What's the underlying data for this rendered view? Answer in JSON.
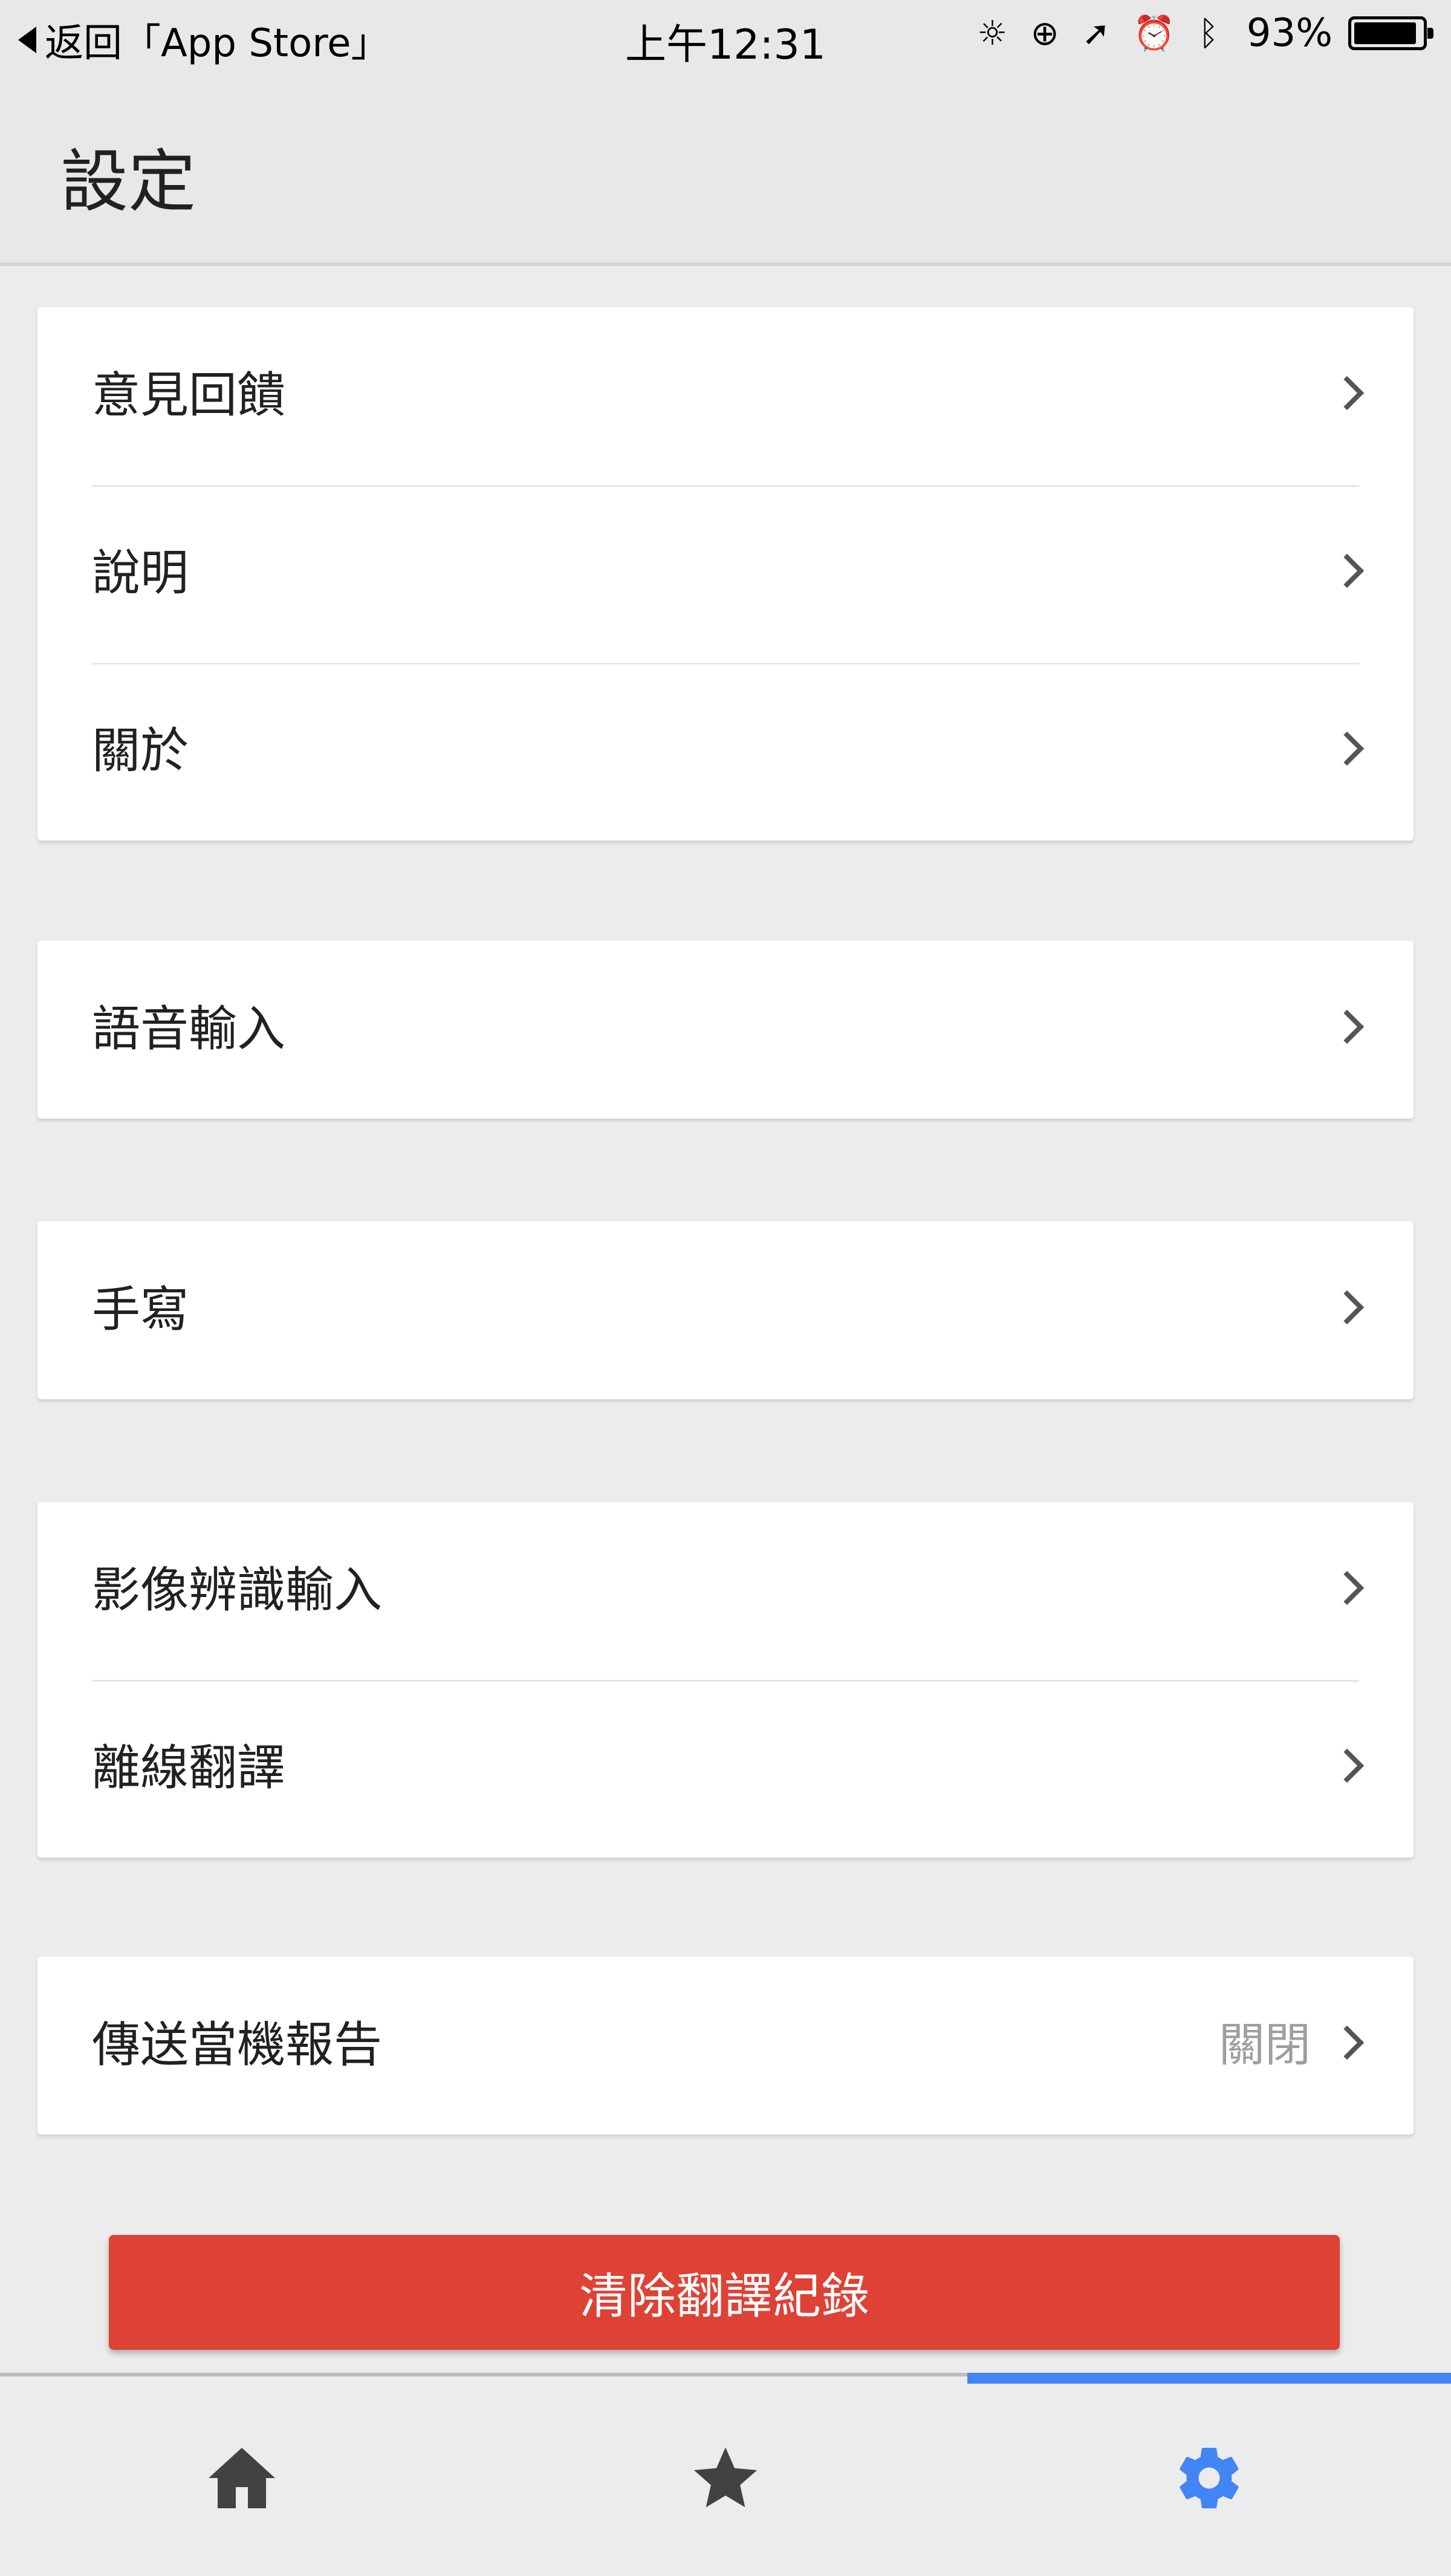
{
  "status_bar": {
    "back_label": "返回「App Store」",
    "time": "上午12:31",
    "battery_percent": "93%",
    "battery_level": 0.93,
    "icons": [
      "brightness-icon",
      "orientation-lock-icon",
      "location-arrow-icon",
      "alarm-icon",
      "bluetooth-icon"
    ]
  },
  "header": {
    "title": "設定"
  },
  "groups": [
    {
      "items": [
        {
          "label": "意見回饋"
        },
        {
          "label": "說明"
        },
        {
          "label": "關於"
        }
      ]
    },
    {
      "items": [
        {
          "label": "語音輸入"
        }
      ]
    },
    {
      "items": [
        {
          "label": "手寫"
        }
      ]
    },
    {
      "items": [
        {
          "label": "影像辨識輸入"
        },
        {
          "label": "離線翻譯"
        }
      ]
    },
    {
      "items": [
        {
          "label": "傳送當機報告",
          "value": "關閉"
        }
      ]
    }
  ],
  "clear_button": {
    "label": "清除翻譯紀錄",
    "color": "#dd4235"
  },
  "bottom_nav": {
    "tabs": [
      {
        "icon": "home-icon",
        "active": false
      },
      {
        "icon": "star-icon",
        "active": false
      },
      {
        "icon": "gear-icon",
        "active": true
      }
    ],
    "active_color": "#4285f4",
    "inactive_color": "#424242"
  }
}
